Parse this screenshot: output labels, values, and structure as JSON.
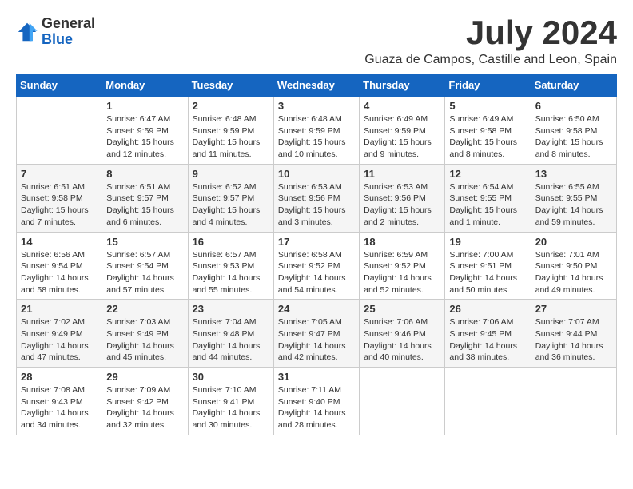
{
  "logo": {
    "general": "General",
    "blue": "Blue"
  },
  "title": {
    "month_year": "July 2024",
    "location": "Guaza de Campos, Castille and Leon, Spain"
  },
  "calendar": {
    "headers": [
      "Sunday",
      "Monday",
      "Tuesday",
      "Wednesday",
      "Thursday",
      "Friday",
      "Saturday"
    ],
    "weeks": [
      [
        {
          "day": "",
          "info": ""
        },
        {
          "day": "1",
          "info": "Sunrise: 6:47 AM\nSunset: 9:59 PM\nDaylight: 15 hours\nand 12 minutes."
        },
        {
          "day": "2",
          "info": "Sunrise: 6:48 AM\nSunset: 9:59 PM\nDaylight: 15 hours\nand 11 minutes."
        },
        {
          "day": "3",
          "info": "Sunrise: 6:48 AM\nSunset: 9:59 PM\nDaylight: 15 hours\nand 10 minutes."
        },
        {
          "day": "4",
          "info": "Sunrise: 6:49 AM\nSunset: 9:59 PM\nDaylight: 15 hours\nand 9 minutes."
        },
        {
          "day": "5",
          "info": "Sunrise: 6:49 AM\nSunset: 9:58 PM\nDaylight: 15 hours\nand 8 minutes."
        },
        {
          "day": "6",
          "info": "Sunrise: 6:50 AM\nSunset: 9:58 PM\nDaylight: 15 hours\nand 8 minutes."
        }
      ],
      [
        {
          "day": "7",
          "info": "Sunrise: 6:51 AM\nSunset: 9:58 PM\nDaylight: 15 hours\nand 7 minutes."
        },
        {
          "day": "8",
          "info": "Sunrise: 6:51 AM\nSunset: 9:57 PM\nDaylight: 15 hours\nand 6 minutes."
        },
        {
          "day": "9",
          "info": "Sunrise: 6:52 AM\nSunset: 9:57 PM\nDaylight: 15 hours\nand 4 minutes."
        },
        {
          "day": "10",
          "info": "Sunrise: 6:53 AM\nSunset: 9:56 PM\nDaylight: 15 hours\nand 3 minutes."
        },
        {
          "day": "11",
          "info": "Sunrise: 6:53 AM\nSunset: 9:56 PM\nDaylight: 15 hours\nand 2 minutes."
        },
        {
          "day": "12",
          "info": "Sunrise: 6:54 AM\nSunset: 9:55 PM\nDaylight: 15 hours\nand 1 minute."
        },
        {
          "day": "13",
          "info": "Sunrise: 6:55 AM\nSunset: 9:55 PM\nDaylight: 14 hours\nand 59 minutes."
        }
      ],
      [
        {
          "day": "14",
          "info": "Sunrise: 6:56 AM\nSunset: 9:54 PM\nDaylight: 14 hours\nand 58 minutes."
        },
        {
          "day": "15",
          "info": "Sunrise: 6:57 AM\nSunset: 9:54 PM\nDaylight: 14 hours\nand 57 minutes."
        },
        {
          "day": "16",
          "info": "Sunrise: 6:57 AM\nSunset: 9:53 PM\nDaylight: 14 hours\nand 55 minutes."
        },
        {
          "day": "17",
          "info": "Sunrise: 6:58 AM\nSunset: 9:52 PM\nDaylight: 14 hours\nand 54 minutes."
        },
        {
          "day": "18",
          "info": "Sunrise: 6:59 AM\nSunset: 9:52 PM\nDaylight: 14 hours\nand 52 minutes."
        },
        {
          "day": "19",
          "info": "Sunrise: 7:00 AM\nSunset: 9:51 PM\nDaylight: 14 hours\nand 50 minutes."
        },
        {
          "day": "20",
          "info": "Sunrise: 7:01 AM\nSunset: 9:50 PM\nDaylight: 14 hours\nand 49 minutes."
        }
      ],
      [
        {
          "day": "21",
          "info": "Sunrise: 7:02 AM\nSunset: 9:49 PM\nDaylight: 14 hours\nand 47 minutes."
        },
        {
          "day": "22",
          "info": "Sunrise: 7:03 AM\nSunset: 9:49 PM\nDaylight: 14 hours\nand 45 minutes."
        },
        {
          "day": "23",
          "info": "Sunrise: 7:04 AM\nSunset: 9:48 PM\nDaylight: 14 hours\nand 44 minutes."
        },
        {
          "day": "24",
          "info": "Sunrise: 7:05 AM\nSunset: 9:47 PM\nDaylight: 14 hours\nand 42 minutes."
        },
        {
          "day": "25",
          "info": "Sunrise: 7:06 AM\nSunset: 9:46 PM\nDaylight: 14 hours\nand 40 minutes."
        },
        {
          "day": "26",
          "info": "Sunrise: 7:06 AM\nSunset: 9:45 PM\nDaylight: 14 hours\nand 38 minutes."
        },
        {
          "day": "27",
          "info": "Sunrise: 7:07 AM\nSunset: 9:44 PM\nDaylight: 14 hours\nand 36 minutes."
        }
      ],
      [
        {
          "day": "28",
          "info": "Sunrise: 7:08 AM\nSunset: 9:43 PM\nDaylight: 14 hours\nand 34 minutes."
        },
        {
          "day": "29",
          "info": "Sunrise: 7:09 AM\nSunset: 9:42 PM\nDaylight: 14 hours\nand 32 minutes."
        },
        {
          "day": "30",
          "info": "Sunrise: 7:10 AM\nSunset: 9:41 PM\nDaylight: 14 hours\nand 30 minutes."
        },
        {
          "day": "31",
          "info": "Sunrise: 7:11 AM\nSunset: 9:40 PM\nDaylight: 14 hours\nand 28 minutes."
        },
        {
          "day": "",
          "info": ""
        },
        {
          "day": "",
          "info": ""
        },
        {
          "day": "",
          "info": ""
        }
      ]
    ]
  }
}
